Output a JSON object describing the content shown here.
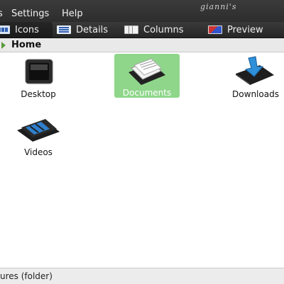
{
  "menubar": {
    "items": [
      "s",
      "Settings",
      "Help"
    ],
    "hostname": "gianni's"
  },
  "toolbar": {
    "buttons": [
      {
        "label": "Icons",
        "icon": "icon-view-icon",
        "active": true
      },
      {
        "label": "Details",
        "icon": "details-view-icon"
      },
      {
        "label": "Columns",
        "icon": "columns-view-icon"
      },
      {
        "label": "Preview",
        "icon": "preview-view-icon"
      }
    ]
  },
  "pathbar": {
    "crumb": "Home"
  },
  "files": [
    {
      "label": "Desktop",
      "icon": "desktop-folder-icon"
    },
    {
      "label": "Documents",
      "icon": "documents-folder-icon",
      "selected": true
    },
    {
      "label": "Downloads",
      "icon": "downloads-folder-icon"
    },
    {
      "label": "Videos",
      "icon": "videos-folder-icon"
    }
  ],
  "statusbar": {
    "text": "ures (folder)"
  },
  "colors": {
    "selection": "#8fd68a",
    "toolbar_bg": "#2d2d2d"
  }
}
